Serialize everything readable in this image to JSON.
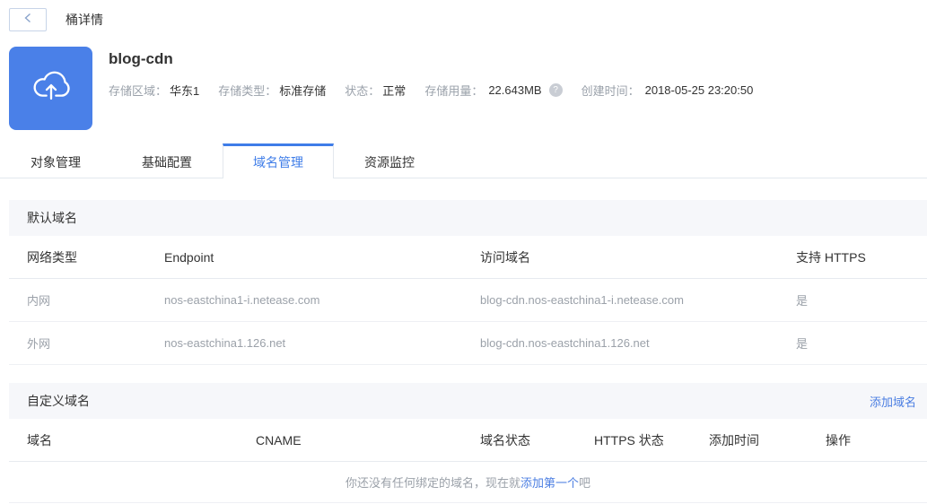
{
  "page": {
    "title": "桶详情"
  },
  "icons": {
    "back": "chevron-left",
    "bucket": "cloud-upload",
    "help": "?"
  },
  "colors": {
    "accent": "#3f7de8",
    "icon_bg": "#4a80e8",
    "muted_text": "#9ba1a9"
  },
  "bucket": {
    "name": "blog-cdn",
    "info": [
      {
        "label": "存储区域：",
        "value": "华东1"
      },
      {
        "label": "存储类型：",
        "value": "标准存储"
      },
      {
        "label": "状态：",
        "value": "正常"
      },
      {
        "label": "存储用量：",
        "value": "22.643MB"
      },
      {
        "label": "创建时间：",
        "value": "2018-05-25 23:20:50"
      }
    ]
  },
  "tabs": [
    {
      "label": "对象管理",
      "active": false
    },
    {
      "label": "基础配置",
      "active": false
    },
    {
      "label": "域名管理",
      "active": true
    },
    {
      "label": "资源监控",
      "active": false
    }
  ],
  "default_domain": {
    "title": "默认域名",
    "columns": [
      "网络类型",
      "Endpoint",
      "访问域名",
      "支持 HTTPS"
    ],
    "rows": [
      [
        "内网",
        "nos-eastchina1-i.netease.com",
        "blog-cdn.nos-eastchina1-i.netease.com",
        "是"
      ],
      [
        "外网",
        "nos-eastchina1.126.net",
        "blog-cdn.nos-eastchina1.126.net",
        "是"
      ]
    ]
  },
  "custom_domain": {
    "title": "自定义域名",
    "add_link": "添加域名",
    "columns": [
      "域名",
      "CNAME",
      "域名状态",
      "HTTPS 状态",
      "添加时间",
      "操作"
    ],
    "empty": {
      "prefix": "你还没有任何绑定的域名，现在就",
      "link": "添加第一个",
      "suffix": "吧"
    }
  }
}
